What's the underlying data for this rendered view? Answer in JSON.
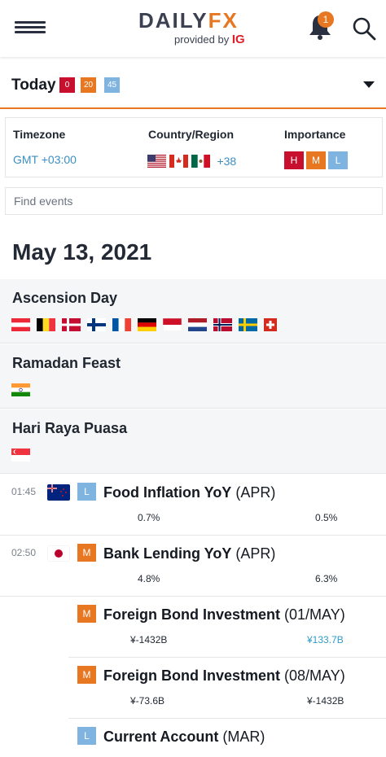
{
  "header": {
    "logo_daily": "DAILY",
    "logo_fx": "FX",
    "logo_provided": "provided by",
    "logo_ig": "IG",
    "notification_count": "1"
  },
  "today_bar": {
    "label": "Today",
    "counts": {
      "high": "0",
      "medium": "20",
      "low": "45"
    }
  },
  "filters": {
    "timezone_label": "Timezone",
    "timezone_value": "GMT +03:00",
    "country_label": "Country/Region",
    "country_flags": [
      "us-flag",
      "ca-flag",
      "mx-flag"
    ],
    "country_more": "+38",
    "importance_label": "Importance",
    "importance": [
      "H",
      "M",
      "L"
    ]
  },
  "search": {
    "placeholder": "Find events"
  },
  "date": "May 13, 2021",
  "holidays": [
    {
      "name": "Ascension Day",
      "flags": [
        "at-flag",
        "be-flag",
        "dk-flag",
        "fi-flag",
        "fr-flag",
        "de-flag",
        "id-flag",
        "nl-flag",
        "no-flag",
        "se-flag",
        "ch-flag"
      ]
    },
    {
      "name": "Ramadan Feast",
      "flags": [
        "in-flag"
      ]
    },
    {
      "name": "Hari Raya Puasa",
      "flags": [
        "sg-flag"
      ]
    }
  ],
  "events": [
    {
      "time": "01:45",
      "flag": "nz-flag",
      "importance": "L",
      "name": "Food Inflation YoY",
      "period": "(APR)",
      "actual": "0.7%",
      "previous": "0.5%"
    },
    {
      "time": "02:50",
      "flag": "jp-flag",
      "importance": "M",
      "name": "Bank Lending YoY",
      "period": "(APR)",
      "actual": "4.8%",
      "previous": "6.3%"
    },
    {
      "time": "",
      "flag": "",
      "importance": "M",
      "name": "Foreign Bond Investment",
      "period": "(01/MAY)",
      "actual": "¥-1432B",
      "previous": "¥133.7B"
    },
    {
      "time": "",
      "flag": "",
      "importance": "M",
      "name": "Foreign Bond Investment",
      "period": "(08/MAY)",
      "actual": "¥-73.6B",
      "previous": "¥-1432B"
    },
    {
      "time": "",
      "flag": "",
      "importance": "L",
      "name": "Current Account",
      "period": "(MAR)",
      "actual": "",
      "previous": ""
    }
  ],
  "colors": {
    "accent": "#e87722",
    "high": "#c8102e",
    "medium": "#e87722",
    "low": "#7fb3e0",
    "link": "#3b8fc4"
  }
}
